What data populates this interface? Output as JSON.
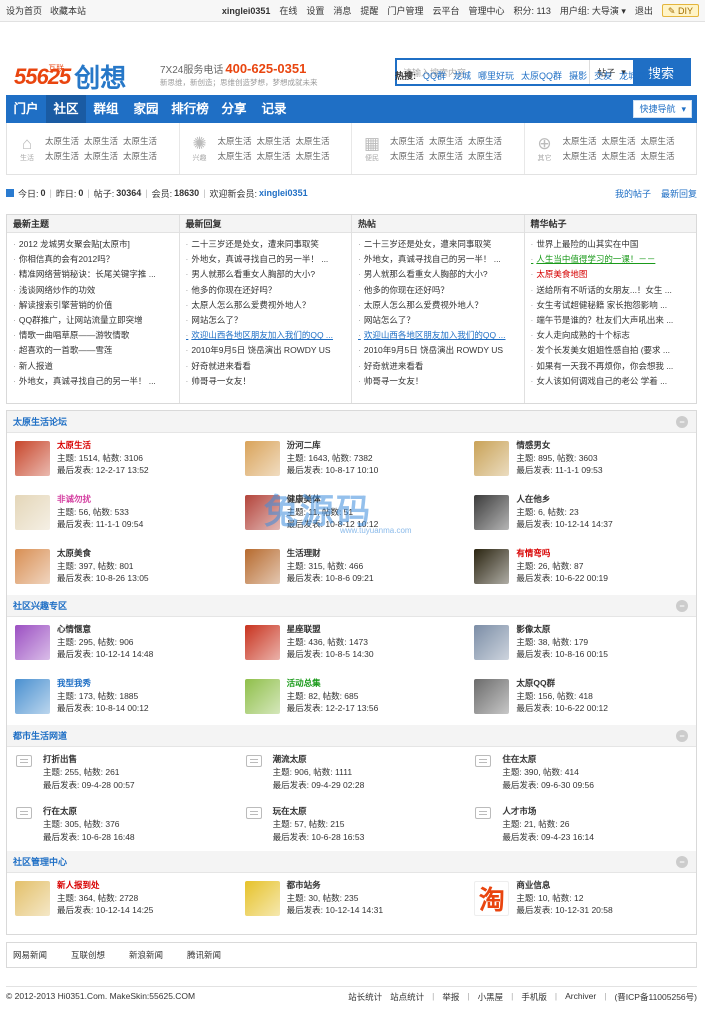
{
  "topbar": {
    "left": [
      "设为首页",
      "收藏本站"
    ],
    "username": "xinglei0351",
    "right": [
      "在线",
      "设置",
      "消息",
      "提醒",
      "门户管理",
      "云平台",
      "管理中心",
      "积分: 113",
      "用户组: 大导演",
      "退出"
    ],
    "diy": "DIY"
  },
  "logo": {
    "num": "55625",
    "small": "互联",
    "text": "创想"
  },
  "slogan": {
    "line1": "7X24服务电话",
    "phone": "400-625-0351",
    "line2": "新思维，新创造；思维创造梦想，梦想成就未来"
  },
  "search": {
    "placeholder": "请输入搜索内容",
    "select": "帖子",
    "button": "搜索"
  },
  "hot": {
    "label": "热搜:",
    "items": [
      "QQ群",
      "龙城",
      "哪里好玩",
      "太原QQ群",
      "摄影",
      "交友",
      "龙城展会"
    ]
  },
  "nav": {
    "items": [
      "门户",
      "社区",
      "群组",
      "家园",
      "排行榜",
      "分享",
      "记录"
    ],
    "quick": "快捷导航"
  },
  "subnav": [
    {
      "icon": "生活",
      "links": [
        "太原生活",
        "太原生活",
        "太原生活",
        "太原生活",
        "太原生活",
        "太原生活"
      ]
    },
    {
      "icon": "兴趣",
      "links": [
        "太原生活",
        "太原生活",
        "太原生活",
        "太原生活",
        "太原生活",
        "太原生活"
      ]
    },
    {
      "icon": "便民",
      "links": [
        "太原生活",
        "太原生活",
        "太原生活",
        "太原生活",
        "太原生活",
        "太原生活"
      ]
    },
    {
      "icon": "其它",
      "links": [
        "太原生活",
        "太原生活",
        "太原生活",
        "太原生活",
        "太原生活",
        "太原生活"
      ]
    }
  ],
  "stats": {
    "today_l": "今日:",
    "today": "0",
    "yest_l": "昨日:",
    "yest": "0",
    "posts_l": "帖子:",
    "posts": "30364",
    "members_l": "会员:",
    "members": "18630",
    "welcome": "欢迎新会员:",
    "newuser": "xinglei0351",
    "my": "我的帖子",
    "latest": "最新回复"
  },
  "topics": [
    {
      "title": "最新主题",
      "items": [
        "2012 龙城男女聚会贴[太原市]",
        "你相信真的会有2012吗？",
        "精准网络营销秘诀：长尾关键字推 ...",
        "浅谈网络炒作的功效",
        "解读搜索引擎营销的价值",
        "QQ群推广，让网站流量立即突增",
        "情歌一曲唱草原——游牧情歌",
        "超喜欢的一首歌——雪莲",
        "新人报道",
        "外地女，真诚寻找自己的另一半！ ..."
      ]
    },
    {
      "title": "最新回复",
      "items": [
        "二十三岁还是处女，遭来同事取笑",
        "外地女，真诚寻找自己的另一半！ ...",
        "男人就那么看重女人胸部的大小?",
        "他多的你现在还好吗？",
        "太原人怎么那么爱费视外地人？",
        "网站怎么了？",
        "欢迎山西各地区朋友加入我们的QQ ...",
        "2010年9月5日 饶岳演出 ROWDY US",
        "好奇就进来看看",
        "帅哥寻一女友！"
      ]
    },
    {
      "title": "热帖",
      "items": [
        "二十三岁还是处女，遭来同事取笑",
        "外地女，真诚寻找自己的另一半！ ...",
        "男人就那么看重女人胸部的大小?",
        "他多的你现在还好吗？",
        "太原人怎么那么爱费视外地人？",
        "网站怎么了？",
        "欢迎山西各地区朋友加入我们的QQ ...",
        "2010年9月5日 饶岳演出 ROWDY US",
        "好奇就进来看看",
        "帅哥寻一女友！"
      ]
    },
    {
      "title": "精华帖子",
      "items": [
        "世界上最险的山其实在中国",
        "人生当中值得学习的一课！－－",
        "太原美食地图",
        "送给所有不听话的女朋友...！女生 ...",
        "女生考试超健秘籍 家长抱怨影响 ...",
        "端午节是谁的？杜友们大声吼出来 ...",
        "女人走向成熟的十个标志",
        "发个长发美女姐姐性感自拍 (要求 ...",
        "如果有一天我不再烦你，你会想我 ...",
        "女人该如何调戏自己的老公 学着 ..."
      ]
    }
  ],
  "sections": [
    {
      "title": "太原生活论坛",
      "forums": [
        {
          "name": "太原生活",
          "topics": "主题: 1514, 帖数: 3106",
          "last": "最后发表: 12-2-17 13:52",
          "color": "#d80000",
          "pic": "#c7462b"
        },
        {
          "name": "汾河二库",
          "topics": "主题: 1643, 帖数: 7382",
          "last": "最后发表: 10-8-17 10:10",
          "color": "#333333",
          "pic": "#d9a35a"
        },
        {
          "name": "情感男女",
          "topics": "主题: 895, 帖数: 3603",
          "last": "最后发表: 11-1-1 09:53",
          "color": "#333333",
          "pic": "#c9a257"
        },
        {
          "name": "非诚勿扰",
          "topics": "主题: 56, 帖数: 533",
          "last": "最后发表: 11-1-1 09:54",
          "color": "#d43ea0",
          "pic": "#e4d6b8"
        },
        {
          "name": "健康美体",
          "topics": "主题: 11, 帖数: 51",
          "last": "最后发表: 10-8-12 10:12",
          "color": "#333333",
          "pic": "#b3443b"
        },
        {
          "name": "人在他乡",
          "topics": "主题: 6, 帖数: 23",
          "last": "最后发表: 10-12-14 14:37",
          "color": "#333333",
          "pic": "#3b3b3b"
        },
        {
          "name": "太原美食",
          "topics": "主题: 397, 帖数: 801",
          "last": "最后发表: 10-8-26 13:05",
          "color": "#333333",
          "pic": "#d88f54"
        },
        {
          "name": "生活理财",
          "topics": "主题: 315, 帖数: 466",
          "last": "最后发表: 10-8-6 09:21",
          "color": "#333333",
          "pic": "#b66a2e"
        },
        {
          "name": "有情弯吗",
          "topics": "主题: 26, 帖数: 87",
          "last": "最后发表: 10-6-22 00:19",
          "color": "#d80000",
          "pic": "#2a2410"
        }
      ]
    },
    {
      "title": "社区兴趣专区",
      "forums": [
        {
          "name": "心情惬意",
          "topics": "主题: 295, 帖数: 906",
          "last": "最后发表: 10-12-14 14:48",
          "color": "#333333",
          "pic": "#9b4fc2"
        },
        {
          "name": "星座联盟",
          "topics": "主题: 436, 帖数: 1473",
          "last": "最后发表: 10-8-5 14:30",
          "color": "#333333",
          "pic": "#c8321e"
        },
        {
          "name": "影像太原",
          "topics": "主题: 38, 帖数: 179",
          "last": "最后发表: 10-8-16 00:15",
          "color": "#333333",
          "pic": "#7b8da6"
        },
        {
          "name": "我型我秀",
          "topics": "主题: 173, 帖数: 1885",
          "last": "最后发表: 10-8-14 00:12",
          "color": "#1f6fc5",
          "pic": "#4a90d0"
        },
        {
          "name": "活动总集",
          "topics": "主题: 82, 帖数: 685",
          "last": "最后发表: 12-2-17 13:56",
          "color": "#1a9a1a",
          "pic": "#8fbf4a"
        },
        {
          "name": "太原QQ群",
          "topics": "主题: 156, 帖数: 418",
          "last": "最后发表: 10-6-22 00:12",
          "color": "#333333",
          "pic": "#6b6b6b"
        }
      ]
    },
    {
      "title": "都市生活网道",
      "forums": [
        {
          "name": "打折出售",
          "topics": "主题: 255, 帖数: 261",
          "last": "最后发表: 09-4-28 00:57"
        },
        {
          "name": "潮流太原",
          "topics": "主题: 906, 帖数: 1111",
          "last": "最后发表: 09-4-29 02:28"
        },
        {
          "name": "住在太原",
          "topics": "主题: 390, 帖数: 414",
          "last": "最后发表: 09-6-30 09:56"
        },
        {
          "name": "行在太原",
          "topics": "主题: 305, 帖数: 376",
          "last": "最后发表: 10-6-28 16:48"
        },
        {
          "name": "玩在太原",
          "topics": "主题: 57, 帖数: 215",
          "last": "最后发表: 10-6-28 16:53"
        },
        {
          "name": "人才市场",
          "topics": "主题: 21, 帖数: 26",
          "last": "最后发表: 09-4-23 16:14"
        }
      ]
    },
    {
      "title": "社区管理中心",
      "forums": [
        {
          "name": "新人报到处",
          "topics": "主题: 364, 帖数: 2728",
          "last": "最后发表: 10-12-14 14:25",
          "color": "#d80000",
          "pic": "#e3c06a"
        },
        {
          "name": "都市站务",
          "topics": "主题: 30, 帖数: 235",
          "last": "最后发表: 10-12-14 14:31",
          "color": "#333333",
          "pic": "#e6c22a"
        },
        {
          "name": "商业信息",
          "topics": "主题: 10, 帖数: 12",
          "last": "最后发表: 10-12-31 20:58",
          "color": "#333333",
          "pic": "#ffffff",
          "glyph": "淘"
        }
      ]
    }
  ],
  "watermark": {
    "big": "兔源码",
    "small": "www.tuyuanma.com"
  },
  "friend_links": [
    "网易新闻",
    "互联创想",
    "新浪新闻",
    "腾讯新闻"
  ],
  "footer": {
    "copyright": "© 2012-2013 Hi0351.Com. MakeSkin:55625.COM",
    "links": [
      "站长统计",
      "站点统计",
      "举报",
      "小黑屋",
      "手机版",
      "Archiver",
      "(晋ICP备11005256号)"
    ]
  }
}
